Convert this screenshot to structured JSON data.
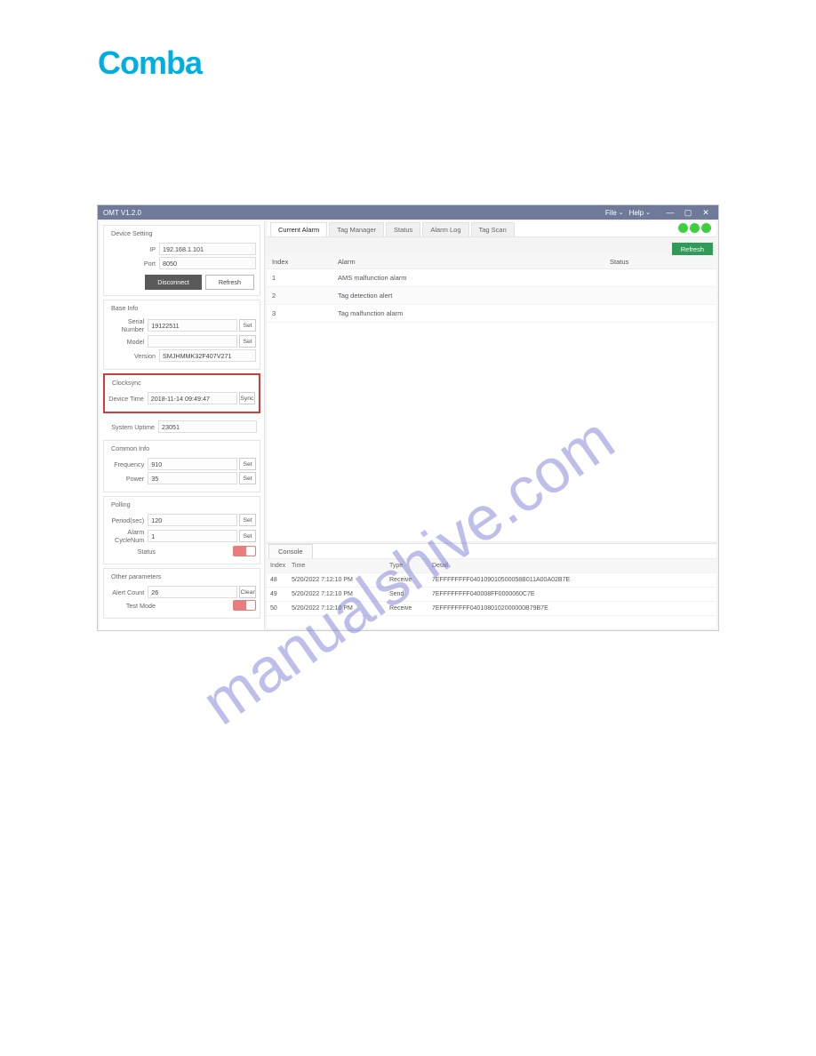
{
  "logo_text": "Comba",
  "watermark": "manualshive.com",
  "window": {
    "title": "OMT V1.2.0",
    "menu_file": "File",
    "menu_help": "Help"
  },
  "tabs": {
    "current_alarm": "Current Alarm",
    "tag_manager": "Tag Manager",
    "status": "Status",
    "alarm_log": "Alarm Log",
    "tag_scan": "Tag Scan"
  },
  "refresh_label": "Refresh",
  "left": {
    "device_setting_title": "Device Setting",
    "ip_label": "IP",
    "ip_value": "192.168.1.101",
    "port_label": "Port",
    "port_value": "8050",
    "disconnect": "Disconnect",
    "refresh": "Refresh",
    "base_info_title": "Base Info",
    "serial_label": "Serial Number",
    "serial_value": "19122511",
    "set": "Set",
    "model_label": "Model",
    "model_value": "",
    "version_label": "Version",
    "version_value": "SMJHMMK32F407V271",
    "clocksync_title": "Clocksync",
    "device_time_label": "Device Time",
    "device_time_value": "2018-11-14 09:49:47",
    "sync": "Sync",
    "uptime_label": "System Uptime",
    "uptime_value": "23051",
    "common_title": "Common Info",
    "freq_label": "Frequency",
    "freq_value": "910",
    "power_label": "Power",
    "power_value": "35",
    "polling_title": "Polling",
    "period_label": "Period(sec)",
    "period_value": "120",
    "alarm_cycle_label": "Alarm CycleNum",
    "alarm_cycle_value": "1",
    "status_label": "Status",
    "other_title": "Other parameters",
    "alert_count_label": "Alert Count",
    "alert_count_value": "26",
    "clear": "Clear",
    "test_mode_label": "Test Mode"
  },
  "alarm_table": {
    "h_index": "Index",
    "h_alarm": "Alarm",
    "h_status": "Status",
    "rows": [
      {
        "i": "1",
        "a": "AMS malfunction alarm"
      },
      {
        "i": "2",
        "a": "Tag detection alert"
      },
      {
        "i": "3",
        "a": "Tag malfunction alarm"
      }
    ]
  },
  "console": {
    "tab": "Console",
    "h_index": "Index",
    "h_time": "Time",
    "h_type": "Type",
    "h_detail": "Detail",
    "rows": [
      {
        "i": "48",
        "t": "5/20/2022 7:12:10 PM",
        "ty": "Receive",
        "d": "7EFFFFFFFF040109010500058B011A00A02B7E"
      },
      {
        "i": "49",
        "t": "5/20/2022 7:12:10 PM",
        "ty": "Send",
        "d": "7EFFFFFFFF040008FF0000060C7E"
      },
      {
        "i": "50",
        "t": "5/20/2022 7:12:10 PM",
        "ty": "Receive",
        "d": "7EFFFFFFFF0401080102000000B79B7E"
      }
    ]
  }
}
